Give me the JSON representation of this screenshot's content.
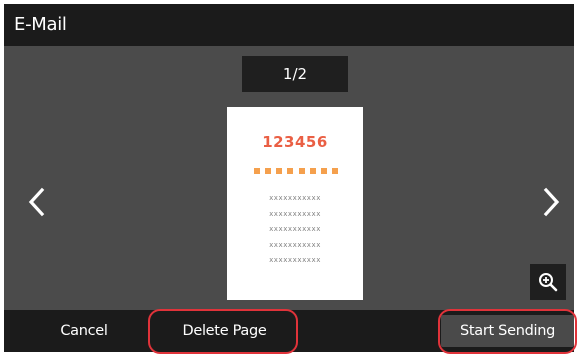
{
  "window": {
    "title": "E-Mail"
  },
  "preview": {
    "page_indicator": "1/2",
    "document_number": "123456",
    "text_lines": [
      "xxxxxxxxxxx",
      "xxxxxxxxxxx",
      "xxxxxxxxxxx",
      "xxxxxxxxxxx",
      "xxxxxxxxxxx"
    ]
  },
  "navigation": {
    "previous_icon": "chevron-left-icon",
    "next_icon": "chevron-right-icon",
    "zoom_icon": "zoom-in-icon"
  },
  "bottom_bar": {
    "cancel_label": "Cancel",
    "delete_label": "Delete Page",
    "start_label": "Start Sending"
  },
  "colors": {
    "screen_background": "#4b4b4b",
    "bar_background": "#1b1b1b",
    "accent_number": "#ea5f44",
    "accent_dots": "#f5a04d",
    "highlight_ring": "#e0333a"
  }
}
